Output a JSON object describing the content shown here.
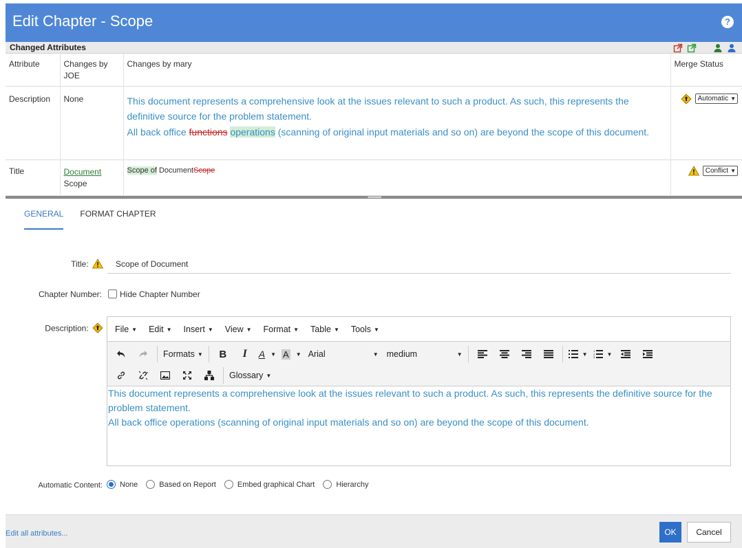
{
  "dialog": {
    "title": "Edit Chapter - Scope",
    "help_icon": "help-icon"
  },
  "changed_bar": {
    "title": "Changed Attributes",
    "icons": [
      "open-external-icon",
      "open-external-green-icon",
      "user-green-icon",
      "user-blue-icon"
    ]
  },
  "changes_table": {
    "headers": {
      "attribute": "Attribute",
      "changes_by_joe": "Changes by JOE",
      "changes_by_mary": "Changes by mary",
      "merge_status": "Merge Status"
    },
    "rows": [
      {
        "attribute": "Description",
        "joe": "None",
        "mary_line1": "This document represents a comprehensive look at the issues relevant to such a product. As such, this represents the definitive source for the problem statement.",
        "mary_line2_prefix": "All back office ",
        "mary_deleted": "functions",
        "mary_inserted": "operations",
        "mary_line2_suffix": " (scanning of original input materials and so on) are beyond the scope of this document.",
        "status": "Automatic"
      },
      {
        "attribute": "Title",
        "joe_link": "Document",
        "joe_text": "Scope",
        "mary_inserted": "Scope of",
        "mary_text": " Document",
        "mary_deleted": "Scope",
        "status": "Conflict"
      }
    ]
  },
  "tabs": [
    {
      "label": "GENERAL",
      "active": true
    },
    {
      "label": "FORMAT CHAPTER",
      "active": false
    }
  ],
  "form": {
    "title_label": "Title:",
    "title_value": "Scope of Document",
    "chapter_number_label": "Chapter Number:",
    "hide_chapter_label": "Hide Chapter Number",
    "description_label": "Description:",
    "automatic_content_label": "Automatic Content:"
  },
  "editor": {
    "menus": [
      "File",
      "Edit",
      "Insert",
      "View",
      "Format",
      "Table",
      "Tools"
    ],
    "formats_label": "Formats",
    "font_name": "Arial",
    "font_size": "medium",
    "glossary_label": "Glossary",
    "content_line1": "This document represents a comprehensive look at the issues relevant to such a product. As such, this represents the definitive source for the problem statement.",
    "content_line2": "All back office operations (scanning of original input materials and so on) are beyond the scope of this document."
  },
  "radio_options": [
    {
      "label": "None",
      "checked": true
    },
    {
      "label": "Based on Report",
      "checked": false
    },
    {
      "label": "Embed graphical Chart",
      "checked": false
    },
    {
      "label": "Hierarchy",
      "checked": false
    }
  ],
  "footer": {
    "edit_all": "Edit all attributes...",
    "ok": "OK",
    "cancel": "Cancel"
  },
  "colors": {
    "header": "#4f87d6",
    "accent": "#2d6fc9",
    "description_text": "#3a8fc5",
    "deleted": "#c62828",
    "inserted_bg": "#d3edd7"
  }
}
